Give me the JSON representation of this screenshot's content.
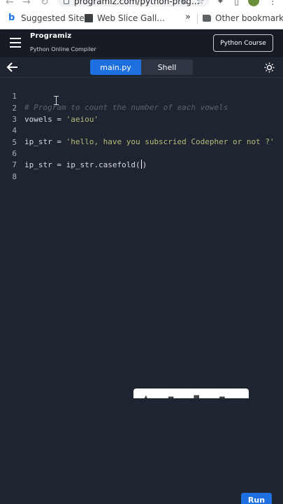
{
  "browser": {
    "url": "programiz.com/python-prog...",
    "bookmarks": [
      {
        "label": "Suggested Sites"
      },
      {
        "label": "Web Slice Gall..."
      }
    ],
    "more_label": "»",
    "other_bookmarks": "Other bookmarks"
  },
  "app": {
    "logo": "Programiz",
    "subtitle": "Python Online Compiler",
    "course_button": "Python Course"
  },
  "tabs": [
    {
      "label": "main.py",
      "active": true
    },
    {
      "label": "Shell",
      "active": false
    }
  ],
  "editor": {
    "lines": [
      {
        "n": "1",
        "comment": "# Program to count the number of each vowels"
      },
      {
        "n": "2",
        "code_a": "vowels = ",
        "str": "'aeiou'"
      },
      {
        "n": "3"
      },
      {
        "n": "4",
        "code_a": "ip_str = ",
        "str": "'hello, have you subscried Codepher or not ?'"
      },
      {
        "n": "5"
      },
      {
        "n": "6",
        "code_a": "ip_str = ip_str.casefold(",
        "code_b": ")"
      },
      {
        "n": "7"
      },
      {
        "n": "8"
      }
    ]
  },
  "run_button": "Run",
  "colors": {
    "accent": "#1e6fe0",
    "editor_bg": "#1e2430",
    "header_bg": "#161b24"
  },
  "icons": [
    "menu-icon",
    "back-arrow-icon",
    "theme-toggle-icon",
    "lock-icon",
    "share-icon",
    "star-icon",
    "puzzle-icon"
  ]
}
